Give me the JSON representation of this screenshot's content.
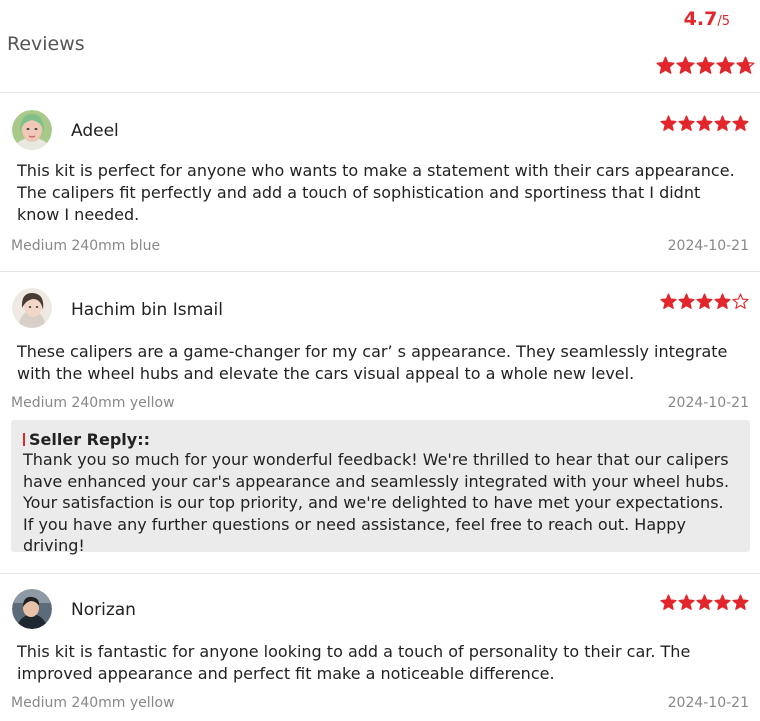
{
  "header": {
    "title": "Reviews",
    "rating": "4.7",
    "rating_max": "/5",
    "rating_value": 4.7
  },
  "colors": {
    "star": "#e3262b",
    "accent": "#e3262b",
    "muted": "#888888",
    "reply_bg": "#ebebeb"
  },
  "reviews": [
    {
      "name": "Adeel",
      "rating": 5,
      "text": "This kit is perfect for anyone who wants to make a statement with their cars appearance. The calipers fit perfectly and add a touch of sophistication and sportiness that I didnt know I needed.",
      "variant": "Medium 240mm blue",
      "date": "2024-10-21"
    },
    {
      "name": "Hachim bin Ismail",
      "rating": 4,
      "text": "These calipers are a game-changer for my car’ s appearance. They seamlessly integrate with the wheel hubs and elevate the cars visual appeal to a whole new level.",
      "variant": "Medium 240mm yellow",
      "date": "2024-10-21",
      "seller_reply": {
        "title": "Seller Reply::",
        "text": "Thank you so much for your wonderful feedback! We're thrilled to hear that our calipers have enhanced your car's appearance and seamlessly integrated with your wheel hubs. Your satisfaction is our top priority, and we're delighted to have met your expectations. If you have any further questions or need assistance, feel free to reach out. Happy driving!"
      }
    },
    {
      "name": "Norizan",
      "rating": 5,
      "text": "This kit is fantastic for anyone looking to add a touch of personality to their car. The improved appearance and perfect fit make a noticeable difference.",
      "variant": "Medium 240mm yellow",
      "date": "2024-10-21"
    }
  ]
}
